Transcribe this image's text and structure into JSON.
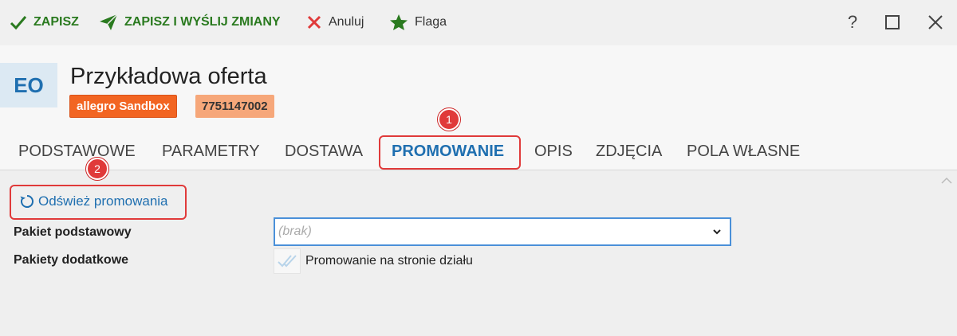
{
  "toolbar": {
    "save_label": "ZAPISZ",
    "save_send_label": "ZAPISZ I WYŚLIJ ZMIANY",
    "cancel_label": "Anuluj",
    "flag_label": "Flaga",
    "help_label": "?"
  },
  "header": {
    "avatar": "EO",
    "title": "Przykładowa oferta",
    "source_badge": "allegro Sandbox",
    "offer_id": "7751147002"
  },
  "tabs": [
    {
      "label": "PODSTAWOWE"
    },
    {
      "label": "PARAMETRY"
    },
    {
      "label": "DOSTAWA"
    },
    {
      "label": "PROMOWANIE",
      "active": true
    },
    {
      "label": "OPIS"
    },
    {
      "label": "ZDJĘCIA"
    },
    {
      "label": "POLA WŁASNE"
    }
  ],
  "markers": {
    "first": "1",
    "second": "2"
  },
  "promo": {
    "refresh_label": "Odśwież promowania",
    "basic_label": "Pakiet podstawowy",
    "basic_placeholder": "(brak)",
    "extra_label": "Pakiety dodatkowe",
    "extra_option": "Promowanie na stronie działu"
  },
  "colors": {
    "accent": "#1f6fb0",
    "highlight": "#e03a3a",
    "badge_source": "#f26522",
    "badge_id": "#f6a77a",
    "save_green": "#2a7a1f"
  },
  "icons": {
    "save": "check-icon",
    "save_send": "send-icon",
    "cancel": "close-x-icon",
    "flag": "star-icon",
    "refresh": "refresh-icon"
  }
}
